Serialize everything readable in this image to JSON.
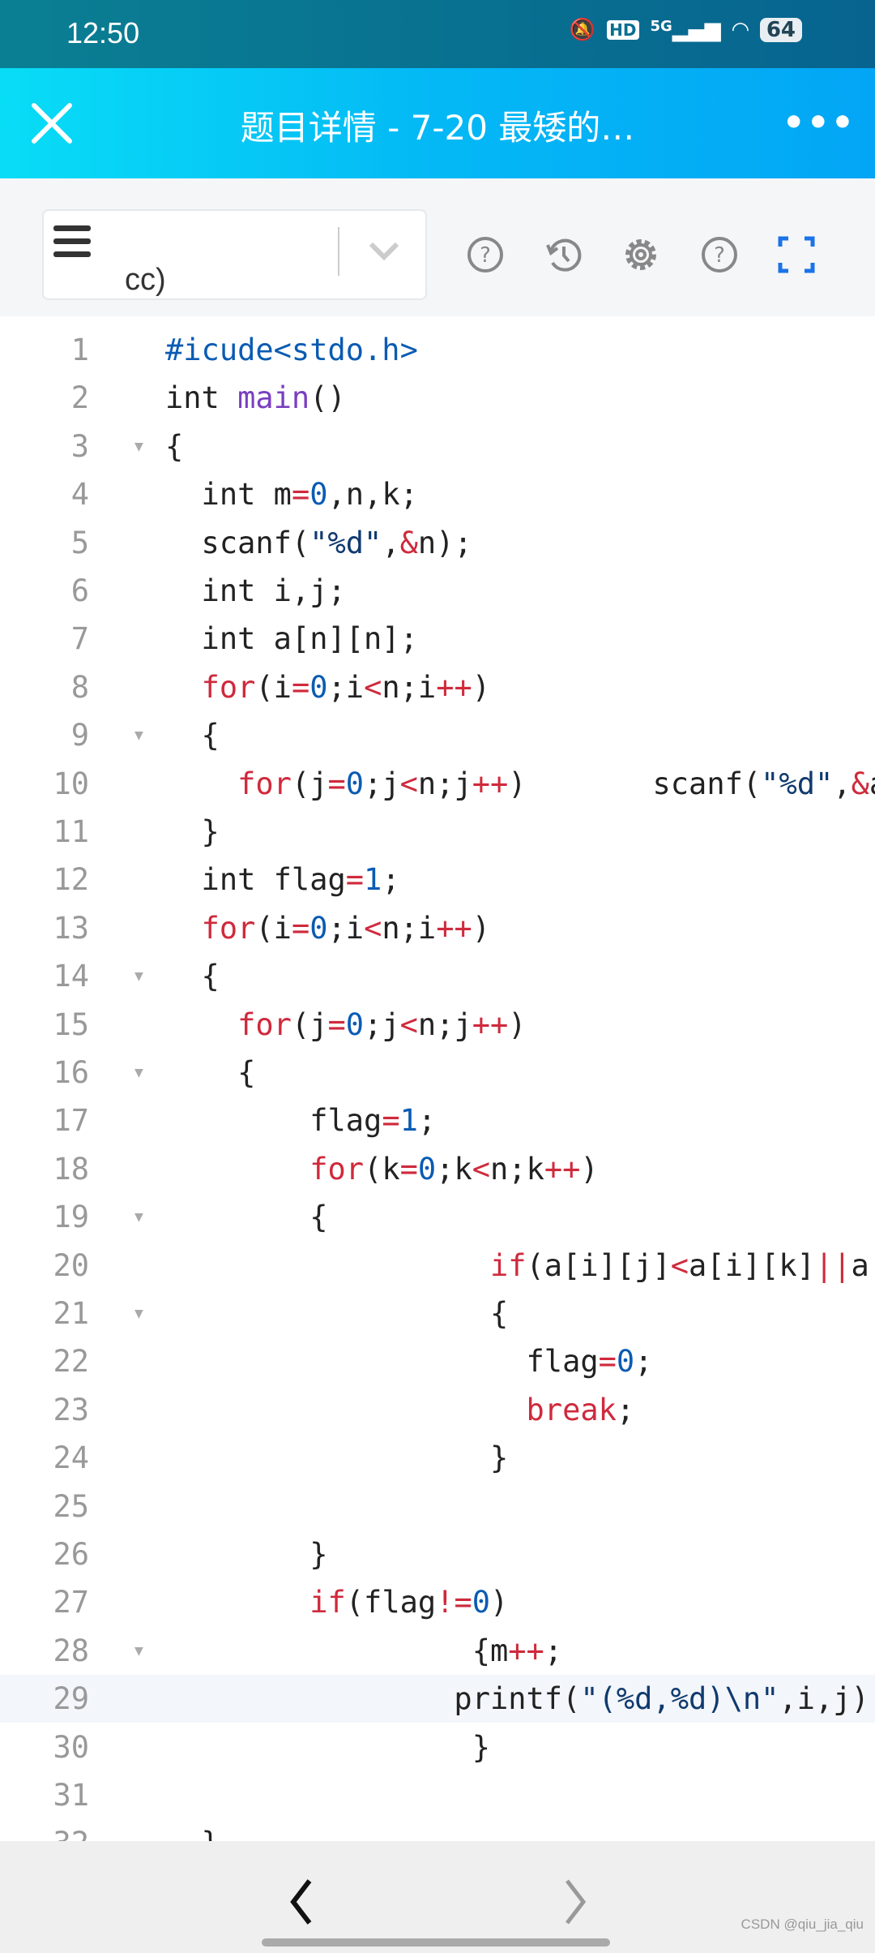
{
  "status_bar": {
    "time": "12:50",
    "network": "5G",
    "hd": "HD",
    "battery": "64"
  },
  "header": {
    "title": "题目详情 - 7-20 最矮的…",
    "close_icon": "close-icon",
    "more_icon": "more-horizontal-icon"
  },
  "toolbar": {
    "language": "cc)",
    "icons": [
      "help-circle-icon",
      "history-icon",
      "gear-icon",
      "help-circle-icon",
      "fullscreen-icon"
    ]
  },
  "colors": {
    "header_start": "#08ddf6",
    "header_end": "#03a6f5",
    "keyword": "#cf2a3c",
    "number": "#0a5bb3",
    "accent": "#1a73e8"
  },
  "editor": {
    "fold_lines": [
      3,
      9,
      14,
      16,
      19,
      21,
      28
    ],
    "highlight_line": 29,
    "lines": [
      {
        "n": "1",
        "t": [
          [
            "#icude<stdo.h>",
            "pp"
          ]
        ]
      },
      {
        "n": "2",
        "t": [
          [
            "int ",
            ""
          ],
          [
            "main",
            "fn"
          ],
          [
            "()",
            ""
          ]
        ]
      },
      {
        "n": "3",
        "t": [
          [
            "{",
            ""
          ]
        ]
      },
      {
        "n": "4",
        "t": [
          [
            "  int m",
            ""
          ],
          [
            "=",
            "op"
          ],
          [
            "0",
            "num"
          ],
          [
            ",n,k;",
            ""
          ]
        ]
      },
      {
        "n": "5",
        "t": [
          [
            "  scanf(",
            ""
          ],
          [
            "\"%d\"",
            "str"
          ],
          [
            ",",
            ""
          ],
          [
            "&",
            "op"
          ],
          [
            "n);",
            ""
          ]
        ]
      },
      {
        "n": "6",
        "t": [
          [
            "  int i,j;",
            ""
          ]
        ]
      },
      {
        "n": "7",
        "t": [
          [
            "  int a[n][n];",
            ""
          ]
        ]
      },
      {
        "n": "8",
        "t": [
          [
            "  ",
            ""
          ],
          [
            "for",
            "kw"
          ],
          [
            "(i",
            ""
          ],
          [
            "=",
            "op"
          ],
          [
            "0",
            "num"
          ],
          [
            ";i",
            ""
          ],
          [
            "<",
            "op"
          ],
          [
            "n;i",
            ""
          ],
          [
            "++",
            "op"
          ],
          [
            ")",
            ""
          ]
        ]
      },
      {
        "n": "9",
        "t": [
          [
            "  {",
            ""
          ]
        ]
      },
      {
        "n": "10",
        "t": [
          [
            "    ",
            ""
          ],
          [
            "for",
            "kw"
          ],
          [
            "(j",
            ""
          ],
          [
            "=",
            "op"
          ],
          [
            "0",
            "num"
          ],
          [
            ";j",
            ""
          ],
          [
            "<",
            "op"
          ],
          [
            "n;j",
            ""
          ],
          [
            "++",
            "op"
          ],
          [
            ")       scanf(",
            ""
          ],
          [
            "\"%d\"",
            "str"
          ],
          [
            ",",
            ""
          ],
          [
            "&",
            "op"
          ],
          [
            "a[i",
            ""
          ]
        ]
      },
      {
        "n": "11",
        "t": [
          [
            "  }",
            ""
          ]
        ]
      },
      {
        "n": "12",
        "t": [
          [
            "  int flag",
            ""
          ],
          [
            "=",
            "op"
          ],
          [
            "1",
            "num"
          ],
          [
            ";",
            ""
          ]
        ]
      },
      {
        "n": "13",
        "t": [
          [
            "  ",
            ""
          ],
          [
            "for",
            "kw"
          ],
          [
            "(i",
            ""
          ],
          [
            "=",
            "op"
          ],
          [
            "0",
            "num"
          ],
          [
            ";i",
            ""
          ],
          [
            "<",
            "op"
          ],
          [
            "n;i",
            ""
          ],
          [
            "++",
            "op"
          ],
          [
            ")",
            ""
          ]
        ]
      },
      {
        "n": "14",
        "t": [
          [
            "  {",
            ""
          ]
        ]
      },
      {
        "n": "15",
        "t": [
          [
            "    ",
            ""
          ],
          [
            "for",
            "kw"
          ],
          [
            "(j",
            ""
          ],
          [
            "=",
            "op"
          ],
          [
            "0",
            "num"
          ],
          [
            ";j",
            ""
          ],
          [
            "<",
            "op"
          ],
          [
            "n;j",
            ""
          ],
          [
            "++",
            "op"
          ],
          [
            ")",
            ""
          ]
        ]
      },
      {
        "n": "16",
        "t": [
          [
            "    {",
            ""
          ]
        ]
      },
      {
        "n": "17",
        "t": [
          [
            "        flag",
            ""
          ],
          [
            "=",
            "op"
          ],
          [
            "1",
            "num"
          ],
          [
            ";",
            ""
          ]
        ]
      },
      {
        "n": "18",
        "t": [
          [
            "        ",
            ""
          ],
          [
            "for",
            "kw"
          ],
          [
            "(k",
            ""
          ],
          [
            "=",
            "op"
          ],
          [
            "0",
            "num"
          ],
          [
            ";k",
            ""
          ],
          [
            "<",
            "op"
          ],
          [
            "n;k",
            ""
          ],
          [
            "++",
            "op"
          ],
          [
            ")",
            ""
          ]
        ]
      },
      {
        "n": "19",
        "t": [
          [
            "        {",
            ""
          ]
        ]
      },
      {
        "n": "20",
        "t": [
          [
            "                  ",
            ""
          ],
          [
            "if",
            "kw"
          ],
          [
            "(a[i][j]",
            ""
          ],
          [
            "<",
            "op"
          ],
          [
            "a[i][k]",
            ""
          ],
          [
            "||",
            "op"
          ],
          [
            "a",
            ""
          ]
        ]
      },
      {
        "n": "21",
        "t": [
          [
            "                  {",
            ""
          ]
        ]
      },
      {
        "n": "22",
        "t": [
          [
            "                    flag",
            ""
          ],
          [
            "=",
            "op"
          ],
          [
            "0",
            "num"
          ],
          [
            ";",
            ""
          ]
        ]
      },
      {
        "n": "23",
        "t": [
          [
            "                    ",
            ""
          ],
          [
            "break",
            "kw"
          ],
          [
            ";",
            ""
          ]
        ]
      },
      {
        "n": "24",
        "t": [
          [
            "                  }",
            ""
          ]
        ]
      },
      {
        "n": "25",
        "t": [
          [
            "",
            ""
          ]
        ]
      },
      {
        "n": "26",
        "t": [
          [
            "        }",
            ""
          ]
        ]
      },
      {
        "n": "27",
        "t": [
          [
            "        ",
            ""
          ],
          [
            "if",
            "kw"
          ],
          [
            "(flag",
            ""
          ],
          [
            "!=",
            "op"
          ],
          [
            "0",
            "num"
          ],
          [
            ")",
            ""
          ]
        ]
      },
      {
        "n": "28",
        "t": [
          [
            "                 {m",
            ""
          ],
          [
            "++",
            "op"
          ],
          [
            ";",
            ""
          ]
        ]
      },
      {
        "n": "29",
        "t": [
          [
            "                printf(",
            ""
          ],
          [
            "\"(%d,%d)\\n\"",
            "str"
          ],
          [
            ",i,j)",
            ""
          ]
        ]
      },
      {
        "n": "30",
        "t": [
          [
            "                 }",
            ""
          ]
        ]
      },
      {
        "n": "31",
        "t": [
          [
            "",
            ""
          ]
        ]
      },
      {
        "n": "32",
        "t": [
          [
            "  }",
            ""
          ]
        ]
      }
    ]
  },
  "bottom_nav": {
    "back_icon": "chevron-left-icon",
    "forward_icon": "chevron-right-icon"
  },
  "watermark": "CSDN @qiu_jia_qiu"
}
